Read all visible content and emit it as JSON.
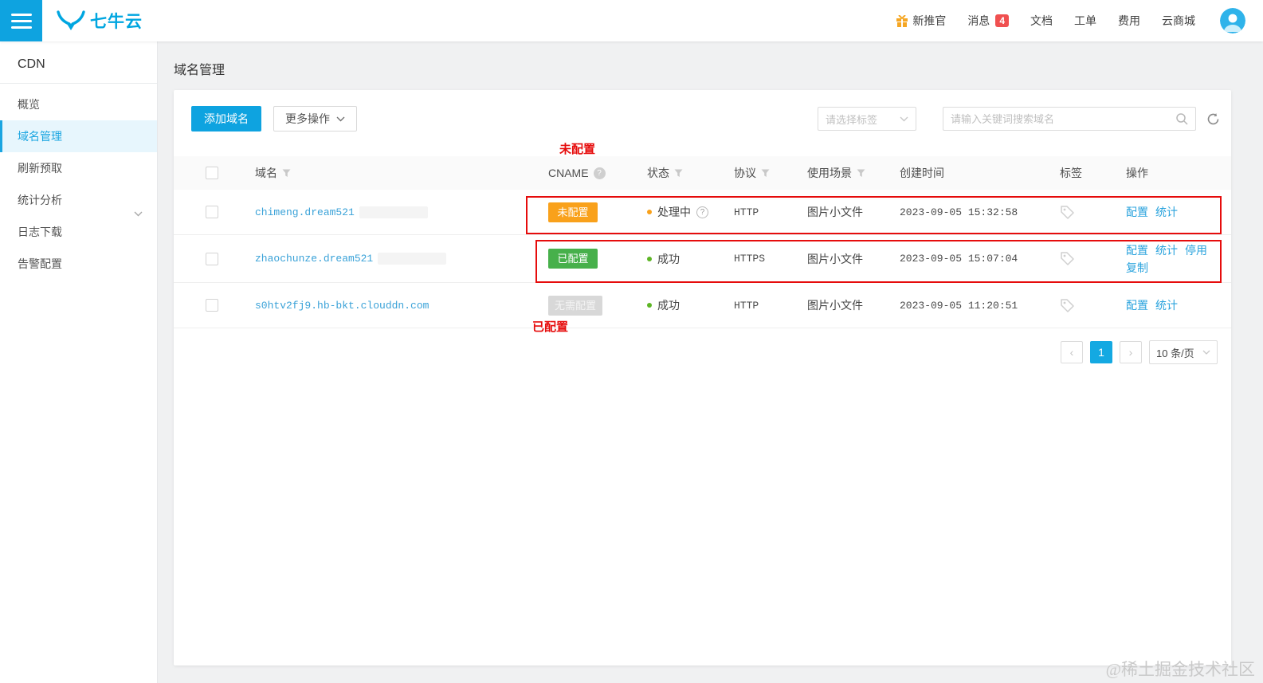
{
  "header": {
    "logo_text": "七牛云",
    "nav": {
      "promo": "新推官",
      "messages": "消息",
      "messages_badge": "4",
      "docs": "文档",
      "tickets": "工单",
      "billing": "费用",
      "marketplace": "云商城"
    }
  },
  "sidebar": {
    "title": "CDN",
    "items": [
      {
        "label": "概览"
      },
      {
        "label": "域名管理"
      },
      {
        "label": "刷新预取"
      },
      {
        "label": "统计分析"
      },
      {
        "label": "日志下载"
      },
      {
        "label": "告警配置"
      }
    ]
  },
  "main": {
    "page_title": "域名管理",
    "toolbar": {
      "add_domain": "添加域名",
      "more_actions": "更多操作",
      "tag_placeholder": "请选择标签",
      "search_placeholder": "请输入关键词搜索域名"
    },
    "table": {
      "columns": [
        "域名",
        "CNAME",
        "状态",
        "协议",
        "使用场景",
        "创建时间",
        "标签",
        "操作"
      ],
      "rows": [
        {
          "domain": "chimeng.dream521",
          "cname_badge": "未配置",
          "status": "处理中",
          "protocol": "HTTP",
          "scene": "图片小文件",
          "created": "2023-09-05 15:32:58",
          "actions": [
            "配置",
            "统计"
          ]
        },
        {
          "domain": "zhaochunze.dream521",
          "cname_badge": "已配置",
          "status": "成功",
          "protocol": "HTTPS",
          "scene": "图片小文件",
          "created": "2023-09-05 15:07:04",
          "actions": [
            "配置",
            "统计",
            "停用",
            "复制"
          ]
        },
        {
          "domain": "s0htv2fj9.hb-bkt.clouddn.com",
          "cname_badge": "无需配置",
          "status": "成功",
          "protocol": "HTTP",
          "scene": "图片小文件",
          "created": "2023-09-05 11:20:51",
          "actions": [
            "配置",
            "统计"
          ]
        }
      ]
    },
    "pagination": {
      "prev": "‹",
      "page": "1",
      "next": "›",
      "page_size": "10 条/页"
    }
  },
  "annotations": {
    "label_top": "未配置",
    "label_bottom": "已配置"
  },
  "watermark": "@稀土掘金技术社区",
  "colors": {
    "brand_blue": "#0ea3e0",
    "link_blue": "#2aa3dd",
    "warning_orange": "#f9a11b",
    "success_green": "#47b04b",
    "neutral_badge_gray": "#d8d8d8",
    "annotation_red": "#e60c0c",
    "message_badge_red": "#f05050"
  }
}
